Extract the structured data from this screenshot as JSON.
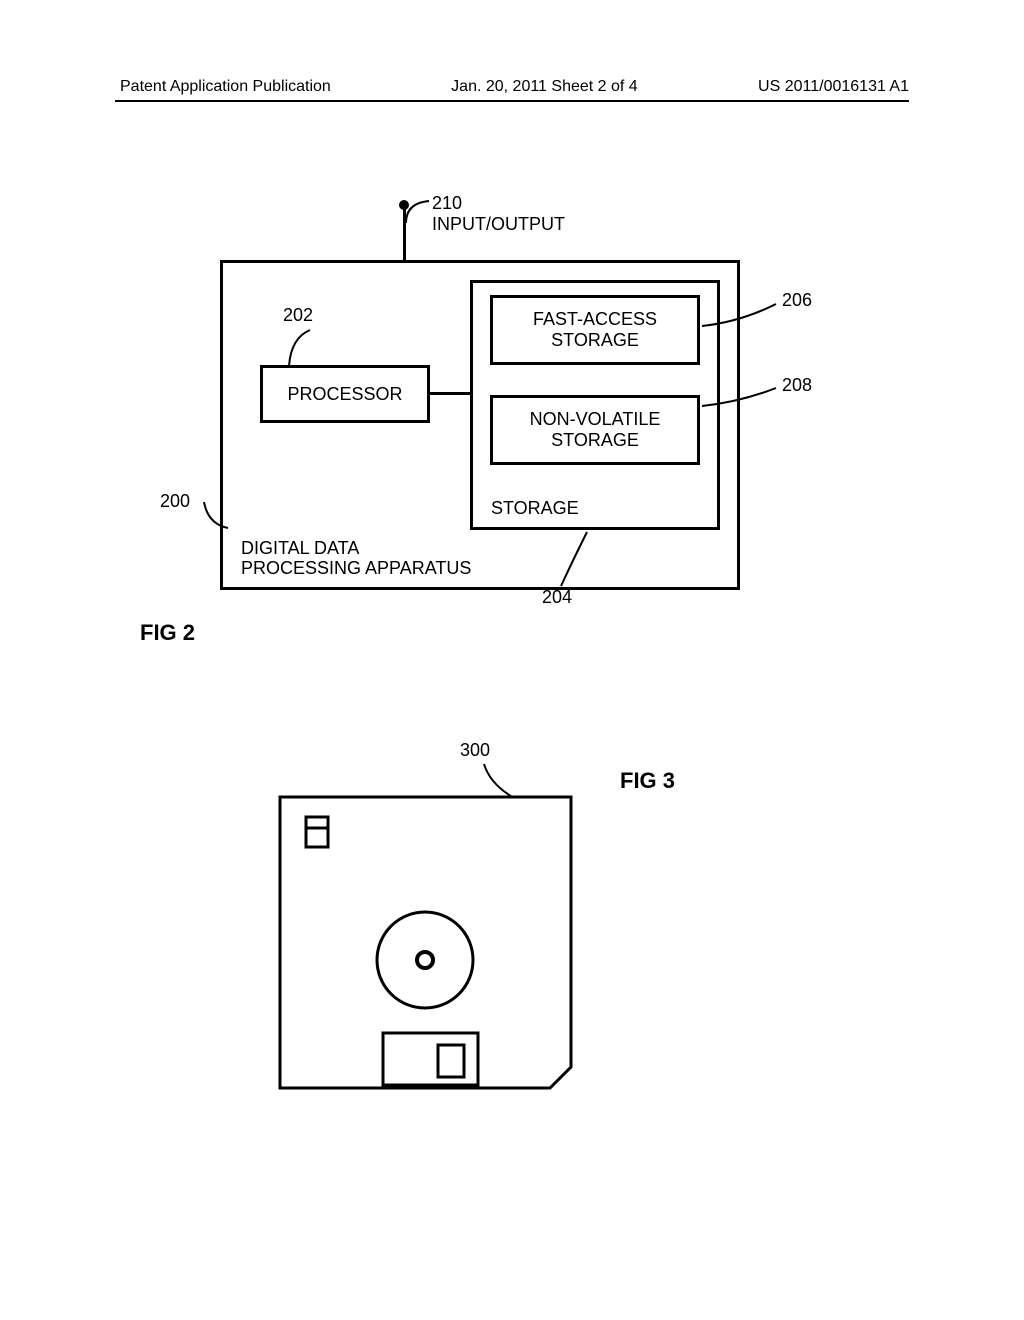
{
  "header": {
    "left": "Patent Application Publication",
    "center": "Jan. 20, 2011  Sheet 2 of 4",
    "right": "US 2011/0016131 A1"
  },
  "fig2": {
    "caption": "FIG 2",
    "io_label": "INPUT/OUTPUT",
    "io_ref": "210",
    "apparatus_ref": "200",
    "apparatus_label_l1": "DIGITAL DATA",
    "apparatus_label_l2": "PROCESSING APPARATUS",
    "processor_ref": "202",
    "processor_label": "PROCESSOR",
    "storage_ref": "204",
    "storage_label": "STORAGE",
    "fast_ref": "206",
    "fast_label_l1": "FAST-ACCESS",
    "fast_label_l2": "STORAGE",
    "nv_ref": "208",
    "nv_label_l1": "NON-VOLATILE",
    "nv_label_l2": "STORAGE"
  },
  "fig3": {
    "caption": "FIG 3",
    "ref": "300"
  }
}
